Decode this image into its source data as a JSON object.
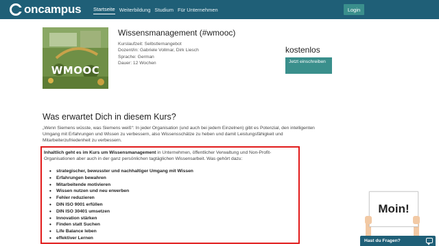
{
  "header": {
    "brand": "oncampus",
    "nav": [
      "Startseite",
      "Weiterbildung",
      "Studium",
      "Für Unternehmen"
    ],
    "login_label": "Login",
    "colors": {
      "bar": "#1f5f77",
      "accent": "#3a8f8c"
    }
  },
  "course": {
    "image_label": "WMOOC",
    "title": "Wissensmanagement (#wmooc)",
    "meta": [
      "Kurslaufzeit: Selbstlernangebot",
      "Dozent/in: Gabriele Vollmar, Dirk Liesch",
      "Sprache: German",
      "Dauer: 12 Wochen"
    ],
    "price": "kostenlos",
    "enroll_label": "Jetzt einschreiben"
  },
  "section": {
    "title": "Was erwartet Dich in diesem Kurs?",
    "intro": "„Wenn Siemens wüsste, was Siemens weiß“: In jeder Organisation (und auch bei jedem Einzelnen) gibt es Potenzial, den intelligenten Umgang mit Erfahrungen und Wissen zu verbessern, also Wissensschätze zu heben und damit Leistungsfähigkeit und Mitarbeiterzufriedenheit zu verbessern.",
    "lead_bold": "Inhaltlich geht es im Kurs um Wissensmanagement",
    "lead_rest": " in Unternehmen, öffentlicher Verwaltung und Non-Profit-Organisationen aber auch in der ganz persönlichen tagtäglichen Wissensarbeit. Was gehört dazu:",
    "bullets": [
      "strategischer, bewusster und nachhaltiger Umgang mit Wissen",
      "Erfahrungen bewahren",
      "Mitarbeitende motivieren",
      "Wissen nutzen und neu erwerben",
      "Fehler reduzieren",
      "DIN ISO 9001 erfüllen",
      "DIN ISO 30401 umsetzen",
      "Innovation stärken",
      "Finden statt Suchen",
      "Life Balance leben",
      "effektiver Lernen"
    ],
    "highlight_color": "#e11a1a"
  },
  "widget": {
    "moin": "Moin!",
    "chat_label": "Hast du Fragen?"
  }
}
